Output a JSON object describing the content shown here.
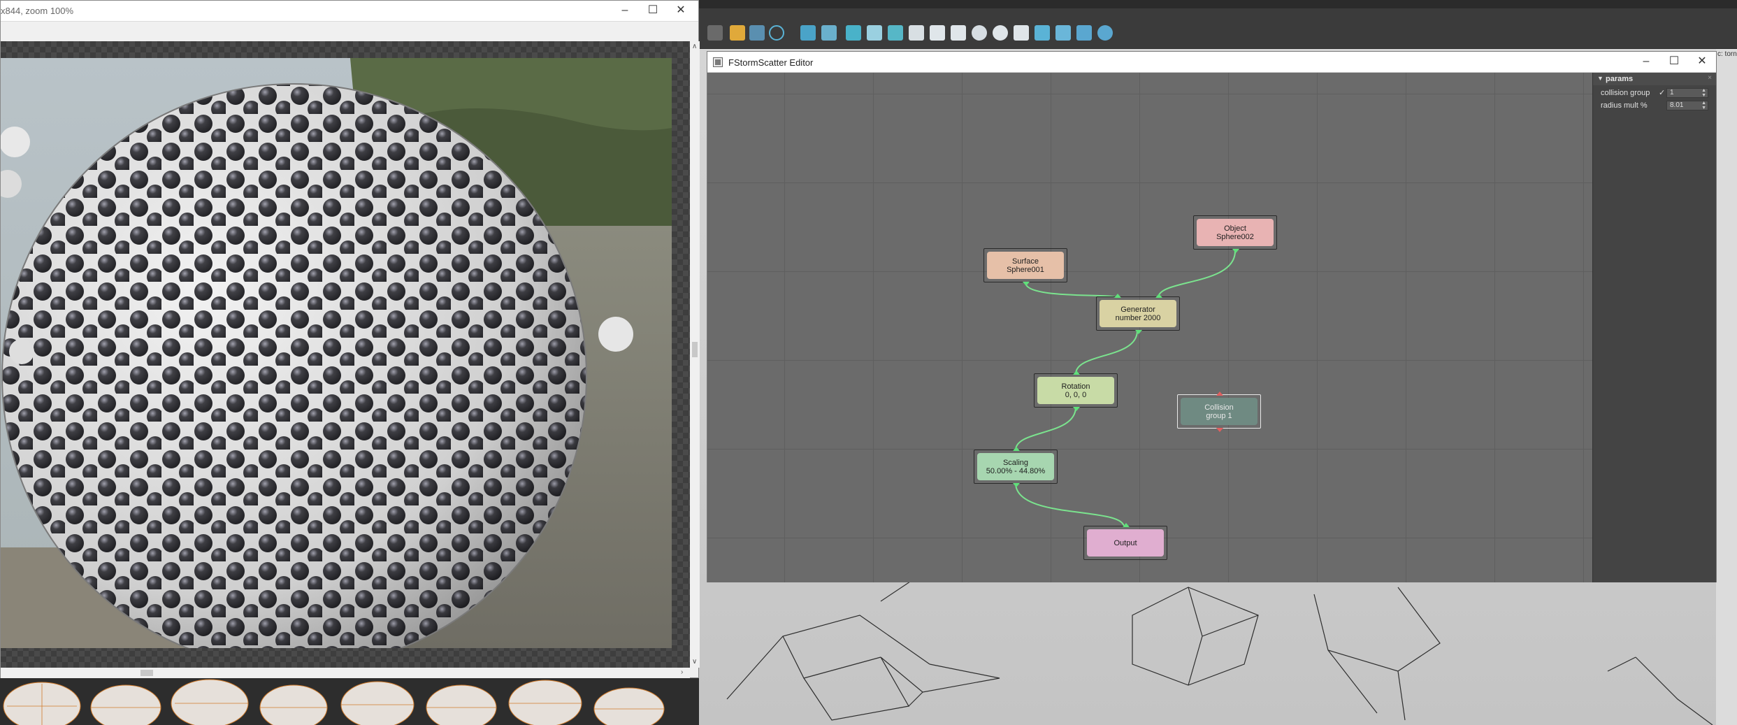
{
  "frame_buffer": {
    "title": "x844, zoom 100%"
  },
  "editor": {
    "title": "FStormScatter Editor",
    "nodes": {
      "surface": {
        "title": "Surface",
        "value": "Sphere001"
      },
      "object": {
        "title": "Object",
        "value": "Sphere002"
      },
      "generator": {
        "title": "Generator",
        "value": "number 2000"
      },
      "rotation": {
        "title": "Rotation",
        "value": "0, 0, 0"
      },
      "collision": {
        "title": "Collision",
        "value": "group 1"
      },
      "scaling": {
        "title": "Scaling",
        "value": "50.00% - 44.80%"
      },
      "output": {
        "title": "Output"
      }
    },
    "params": {
      "header": "params",
      "collision_group_label": "collision group",
      "collision_group_value": "1",
      "radius_mult_label": "radius mult %",
      "radius_mult_value": "8.01"
    },
    "node_colors": {
      "surface": "#e6c0a8",
      "object": "#e8b3b3",
      "generator": "#d9d2a3",
      "rotation": "#c8dba6",
      "collision": "#6f8a82",
      "scaling": "#a7d6b0",
      "output": "#e0aed0"
    }
  },
  "right_edge_text": "c: torn"
}
